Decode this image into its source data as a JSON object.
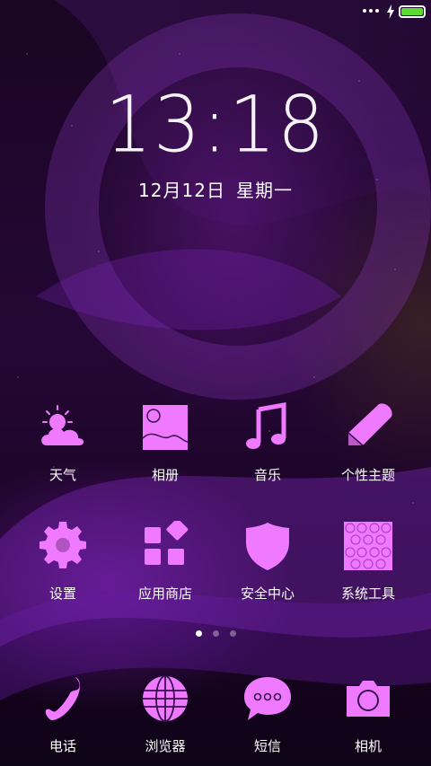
{
  "status_bar": {
    "battery_level": 1.0,
    "battery_color": "#5bdc2d",
    "charging": true
  },
  "clock": {
    "time": "13:18",
    "date": "12月12日",
    "weekday": "星期一"
  },
  "accent_color": "#f07aff",
  "page_indicator": {
    "pages": 3,
    "active_index": 0
  },
  "apps": [
    {
      "label": "天气",
      "icon": "weather-icon"
    },
    {
      "label": "相册",
      "icon": "gallery-icon"
    },
    {
      "label": "音乐",
      "icon": "music-icon"
    },
    {
      "label": "个性主题",
      "icon": "theme-icon"
    },
    {
      "label": "设置",
      "icon": "settings-icon"
    },
    {
      "label": "应用商店",
      "icon": "app-store-icon"
    },
    {
      "label": "安全中心",
      "icon": "security-icon"
    },
    {
      "label": "系统工具",
      "icon": "tools-icon"
    }
  ],
  "dock": [
    {
      "label": "电话",
      "icon": "phone-icon"
    },
    {
      "label": "浏览器",
      "icon": "browser-icon"
    },
    {
      "label": "短信",
      "icon": "messages-icon"
    },
    {
      "label": "相机",
      "icon": "camera-icon"
    }
  ]
}
